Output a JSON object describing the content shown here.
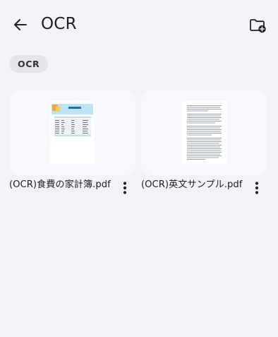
{
  "header": {
    "title": "OCR",
    "back_icon": "arrow-left-icon",
    "new_folder_icon": "folder-plus-icon"
  },
  "filter_chip": {
    "label": "OCR"
  },
  "files": [
    {
      "name": "(OCR)食費の家計簿.pdf",
      "thumbnail": "spreadsheet-page",
      "more_icon": "more-vert-icon"
    },
    {
      "name": "(OCR)英文サンプル.pdf",
      "thumbnail": "text-page",
      "more_icon": "more-vert-icon"
    }
  ],
  "colors": {
    "background": "#f1f3f8",
    "card": "#f7f8fb",
    "chip": "#e3e5eb",
    "text": "#1f1f1f",
    "accent": "#4aa3df"
  }
}
